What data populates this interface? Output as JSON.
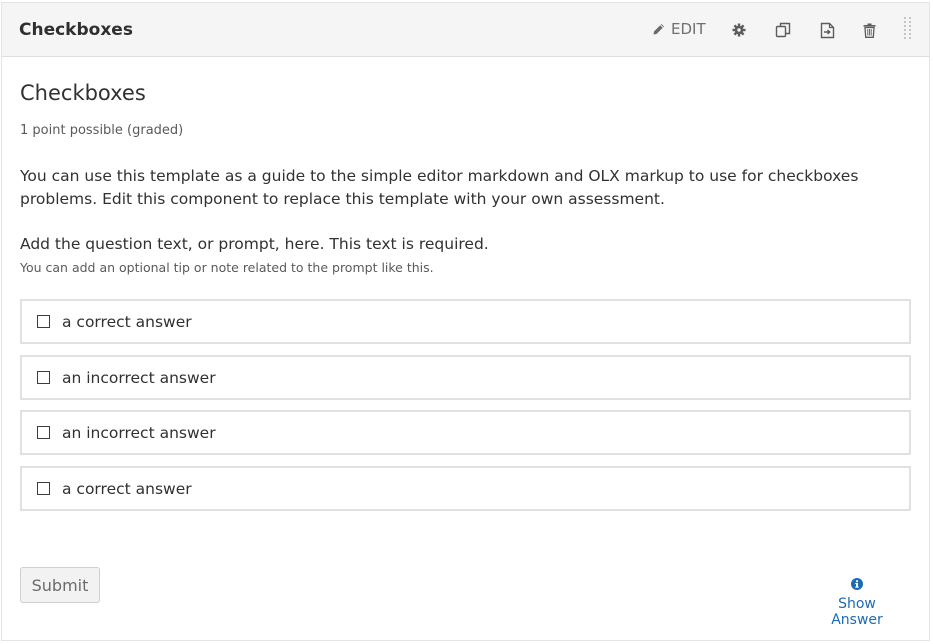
{
  "header": {
    "title": "Checkboxes",
    "edit_label": "EDIT",
    "icons": [
      "pencil-icon",
      "gear-icon",
      "duplicate-icon",
      "move-icon",
      "trash-icon",
      "drag-handle-icon"
    ]
  },
  "problem": {
    "title": "Checkboxes",
    "points": "1 point possible (graded)",
    "description": "You can use this template as a guide to the simple editor markdown and OLX markup to use for checkboxes problems. Edit this component to replace this template with your own assessment.",
    "prompt": "Add the question text, or prompt, here. This text is required.",
    "tip": "You can add an optional tip or note related to the prompt like this.",
    "options": [
      {
        "label": "a correct answer",
        "checked": false
      },
      {
        "label": "an incorrect answer",
        "checked": false
      },
      {
        "label": "an incorrect answer",
        "checked": false
      },
      {
        "label": "a correct answer",
        "checked": false
      }
    ]
  },
  "actions": {
    "submit_label": "Submit",
    "show_answer_label": "Show Answer"
  },
  "colors": {
    "link": "#1d6bb3",
    "header_bg": "#f5f5f5",
    "border": "#e1e1e1"
  }
}
